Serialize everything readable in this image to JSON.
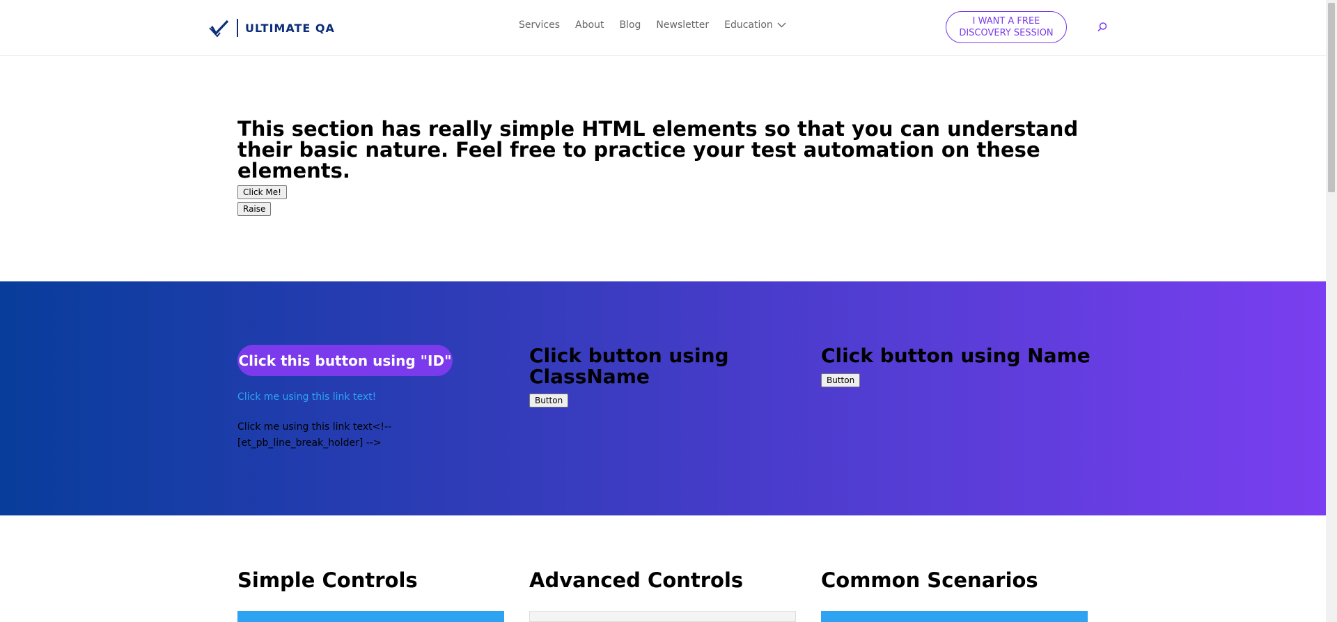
{
  "header": {
    "logo_text": "ULTIMATE QA",
    "nav": [
      "Services",
      "About",
      "Blog",
      "Newsletter",
      "Education"
    ],
    "cta_label": "I WANT A FREE DISCOVERY SESSION"
  },
  "intro": {
    "title": "This section has really simple HTML elements so that you can understand their basic nature. Feel free to practice your test automation on these elements.",
    "click_me": "Click Me!",
    "raise": "Raise"
  },
  "band": {
    "id_button": "Click this button using \"ID\"",
    "link_blue": "Click me using this link text!",
    "link_text": "Click me using this link text<!-- [et_pb_line_break_holder] -->",
    "classname_title": "Click button using ClassName",
    "classname_button": "Button",
    "name_title": "Click button using Name",
    "name_button": "Button"
  },
  "sections": {
    "simple": "Simple Controls",
    "advanced": "Advanced Controls",
    "common": "Common Scenarios"
  },
  "colors": {
    "brand_navy": "#0b2d7a",
    "accent_purple": "#7c3aed",
    "link_blue": "#2ea3f2",
    "gradient_start": "#083d9b",
    "gradient_end": "#7a3ef0"
  }
}
